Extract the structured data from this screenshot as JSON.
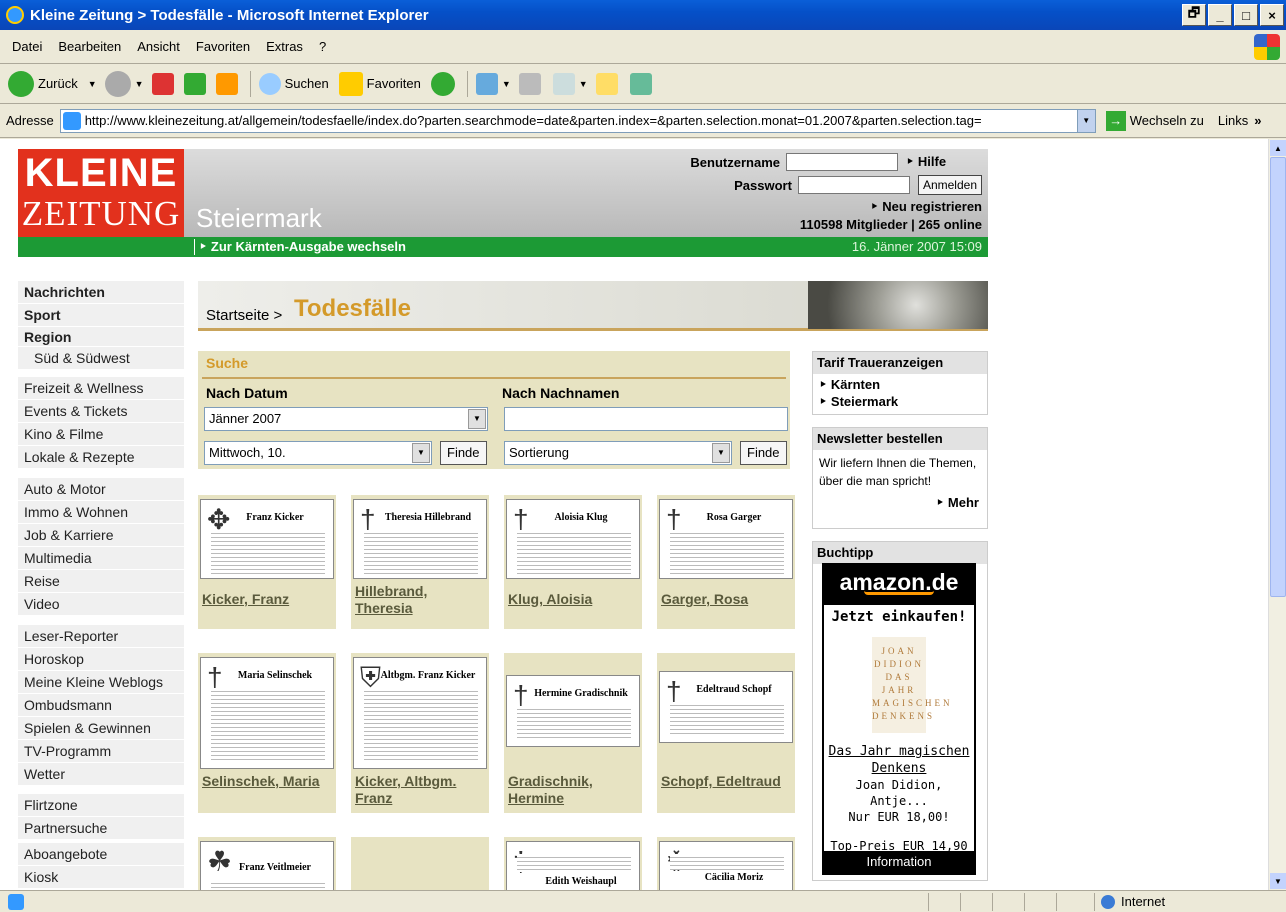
{
  "window": {
    "title": "Kleine Zeitung > Todesfälle - Microsoft Internet Explorer",
    "controls": [
      "🗗",
      "_",
      "□",
      "×"
    ]
  },
  "menu": [
    "Datei",
    "Bearbeiten",
    "Ansicht",
    "Favoriten",
    "Extras",
    "?"
  ],
  "toolbar": {
    "back_label": "Zurück",
    "search_label": "Suchen",
    "favorites_label": "Favoriten"
  },
  "address": {
    "label": "Adresse",
    "url": "http://www.kleinezeitung.at/allgemein/todesfaelle/index.do?parten.searchmode=date&parten.index=&parten.selection.monat=01.2007&parten.selection.tag=",
    "go_label": "Wechseln zu",
    "links_label": "Links",
    "more": "»"
  },
  "site": {
    "logo_line1": "KLEINE",
    "logo_line2": "ZEITUNG",
    "region": "Steiermark",
    "login": {
      "username_label": "Benutzername",
      "password_label": "Passwort",
      "help_link": "‣ Hilfe",
      "login_button": "Anmelden",
      "register_link": "‣ Neu registrieren",
      "members": "110598 Mitglieder | 265 online"
    },
    "switch_edition": "‣ Zur Kärnten-Ausgabe wechseln",
    "datetime": "16. Jänner 2007 15:09"
  },
  "nav": {
    "group1": [
      "Nachrichten",
      "Sport",
      "Region"
    ],
    "group1_sub": "Süd & Südwest",
    "group2": [
      "Freizeit & Wellness",
      "Events & Tickets",
      "Kino & Filme",
      "Lokale & Rezepte"
    ],
    "group3": [
      "Auto & Motor",
      "Immo & Wohnen",
      "Job & Karriere",
      "Multimedia",
      "Reise",
      "Video"
    ],
    "group4": [
      "Leser-Reporter",
      "Horoskop",
      "Meine Kleine Weblogs",
      "Ombudsmann",
      "Spielen & Gewinnen",
      "TV-Programm",
      "Wetter"
    ],
    "group5": [
      "Flirtzone",
      "Partnersuche"
    ],
    "group6": [
      "Aboangebote",
      "Kiosk"
    ]
  },
  "breadcrumb": {
    "start": "Startseite >",
    "title": "Todesfälle"
  },
  "search": {
    "heading": "Suche",
    "by_date_label": "Nach Datum",
    "by_name_label": "Nach Nachnamen",
    "month_value": "Jänner 2007",
    "day_value": "Mittwoch, 10.",
    "sort_value": "Sortierung",
    "find_label": "Finde",
    "name_value": ""
  },
  "obituaries": [
    {
      "name": "Kicker, Franz",
      "thumb": "Franz Kicker"
    },
    {
      "name": "Hillebrand, Theresia",
      "thumb": "Theresia Hillebrand"
    },
    {
      "name": "Klug, Aloisia",
      "thumb": "Aloisia Klug"
    },
    {
      "name": "Garger, Rosa",
      "thumb": "Rosa Garger"
    },
    {
      "name": "Selinschek, Maria",
      "thumb": "Maria Selinschek"
    },
    {
      "name": "Kicker, Altbgm. Franz",
      "thumb": "Altbgm. Franz Kicker"
    },
    {
      "name": "Gradischnik, Hermine",
      "thumb": "Hermine Gradischnik"
    },
    {
      "name": "Schopf, Edeltraud",
      "thumb": "Edeltraud Schopf"
    },
    {
      "name": "",
      "thumb": "Franz Veitlmeier"
    },
    {
      "name": "",
      "thumb": ""
    },
    {
      "name": "",
      "thumb": "Edith Weishaupl"
    },
    {
      "name": "",
      "thumb": "Cäcilia Moriz"
    }
  ],
  "sidebar": {
    "tarif_title": "Tarif Traueranzeigen",
    "tarif_links": [
      "‣ Kärnten",
      "‣ Steiermark"
    ],
    "newsletter_title": "Newsletter bestellen",
    "newsletter_text": "Wir liefern Ihnen die Themen, über die man spricht!",
    "newsletter_more": "‣ Mehr",
    "buchtipp_title": "Buchtipp",
    "amazon_logo": "amazon.de",
    "amazon_cta": "Jetzt einkaufen!",
    "book_cover": "JOAN DIDION DAS JAHR MAGISCHEN DENKENS",
    "book_title": "Das Jahr magischen Denkens",
    "book_authors": "Joan Didion, Antje...",
    "book_price": "Nur EUR 18,00!",
    "top_price": "Top-Preis EUR 14,90",
    "amazon_footer": "Information"
  },
  "status": {
    "zone": "Internet"
  }
}
